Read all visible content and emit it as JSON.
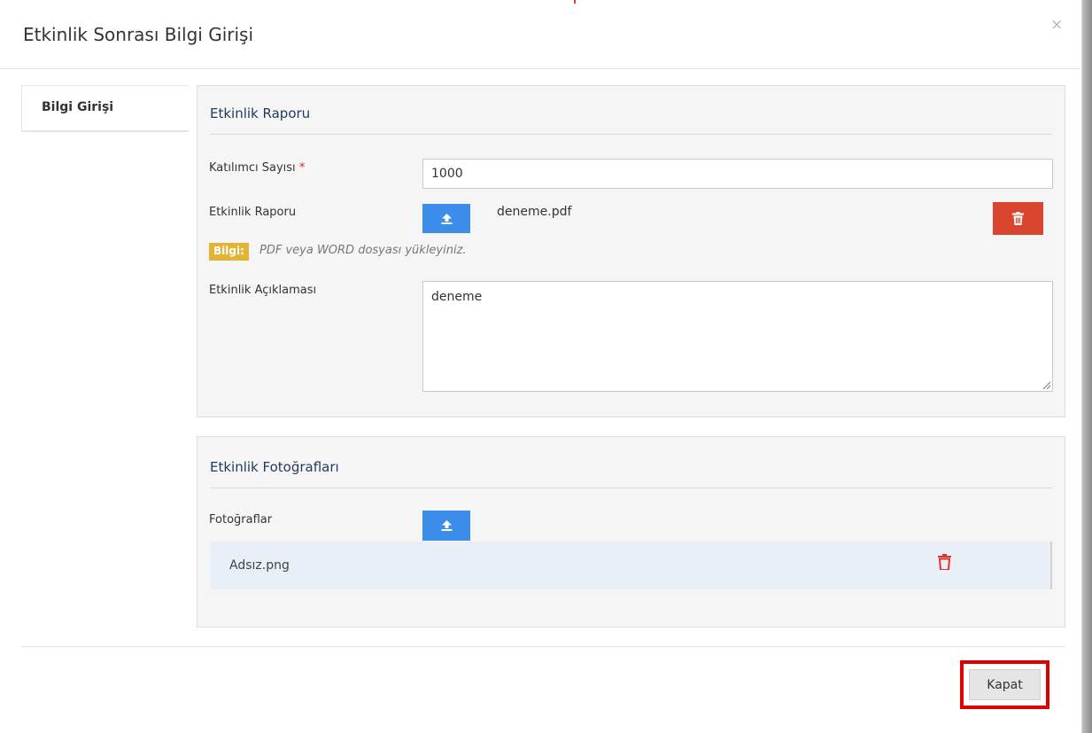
{
  "modal": {
    "title": "Etkinlik Sonrası Bilgi Girişi",
    "close_glyph": "×"
  },
  "tabs": [
    {
      "label": "Bilgi Girişi",
      "active": true
    }
  ],
  "report_panel": {
    "title": "Etkinlik Raporu",
    "participant_label": "Katılımcı Sayısı",
    "required_mark": "*",
    "participant_value": "1000",
    "report_label": "Etkinlik Raporu",
    "report_file": "deneme.pdf",
    "info_badge": "Bilgi:",
    "info_text": "PDF veya WORD dosyası yükleyiniz.",
    "description_label": "Etkinlik Açıklaması",
    "description_value": "deneme"
  },
  "photos_panel": {
    "title": "Etkinlik Fotoğrafları",
    "photos_label": "Fotoğraflar",
    "files": [
      {
        "name": "Adsız.png"
      }
    ]
  },
  "footer": {
    "close_button": "Kapat"
  },
  "icons": {
    "upload": "upload-icon",
    "delete": "trash-icon",
    "close": "close-icon"
  },
  "colors": {
    "upload_blue": "#3c8dea",
    "delete_red": "#d9452f",
    "info_yellow": "#e0b436",
    "panel_title": "#1f3a5c",
    "highlight_red": "#e10000"
  }
}
